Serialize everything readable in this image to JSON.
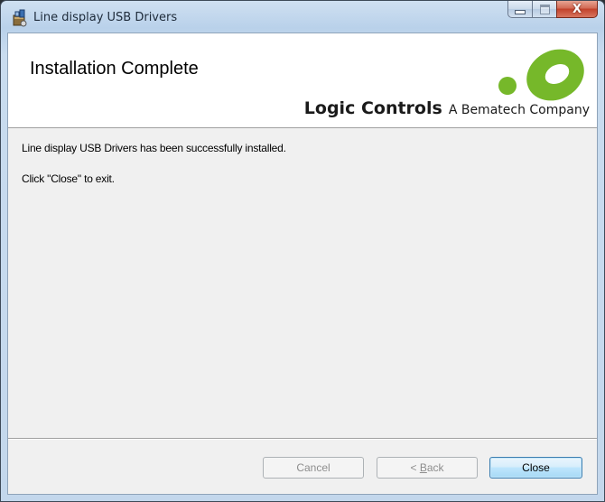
{
  "window": {
    "title": "Line display USB Drivers",
    "title_icon": "installer-icon",
    "caption_buttons": {
      "minimize": "minimize-icon",
      "maximize": "maximize-icon",
      "close": "close-icon",
      "close_glyph": "X"
    }
  },
  "banner": {
    "heading": "Installation Complete",
    "logo_icon": "logic-controls-logo",
    "brand_name": "Logic Controls",
    "brand_tagline": "A Bematech Company",
    "logo_color": "#76b82a"
  },
  "body": {
    "line1": "Line display USB Drivers has been successfully installed.",
    "line2": "Click \"Close\" to exit."
  },
  "buttons": {
    "cancel": "Cancel",
    "back_mnemonic": "B",
    "back_rest": "ack",
    "back_prefix": "< ",
    "close": "Close"
  },
  "colors": {
    "title_bar": "#b9d1ea",
    "close_button": "#c2412a",
    "default_button_border": "#3c7fb1"
  }
}
